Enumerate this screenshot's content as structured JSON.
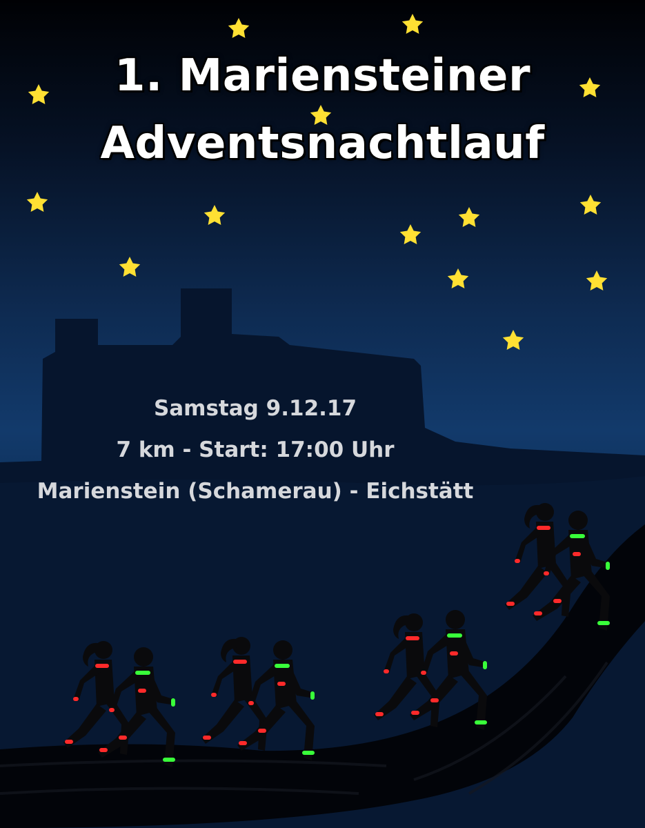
{
  "title": {
    "line1": "1. Mariensteiner",
    "line2": "Adventsnachtlauf"
  },
  "info": {
    "date": "Samstag 9.12.17",
    "distance_start": "7 km - Start: 17:00 Uhr",
    "location": "Marienstein (Schamerau) - Eichstätt"
  },
  "colors": {
    "sky_top": "#000104",
    "sky_bottom": "#123a6b",
    "star": "#ffe033",
    "moon": "#ffe033",
    "silhouette": "#0a0a0c",
    "castle": "#06152d",
    "band_red": "#ff2a2a",
    "band_green": "#39ff3a",
    "title_text": "#ffffff",
    "info_text": "#d6d8dc"
  },
  "icons": [
    "star-icon",
    "crescent-moon-icon",
    "castle-silhouette",
    "runner-silhouette"
  ]
}
